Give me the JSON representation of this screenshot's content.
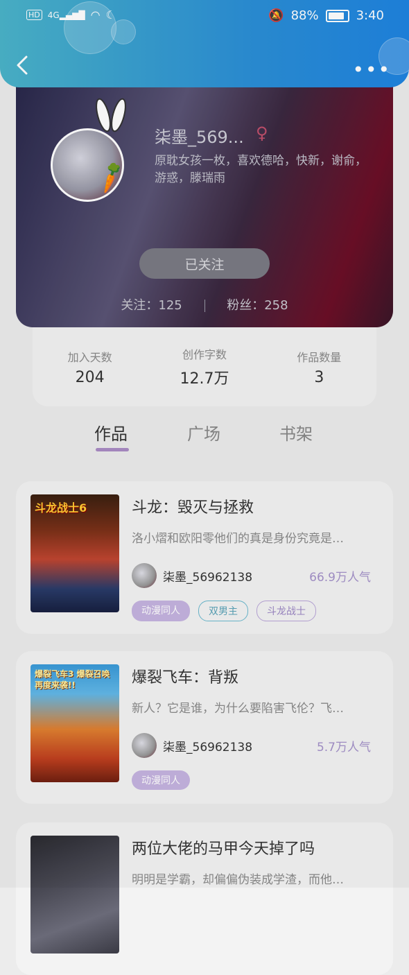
{
  "status_bar": {
    "network": "4G",
    "battery": "88%",
    "time": "3:40",
    "hd": "HD"
  },
  "profile": {
    "nickname": "柒墨_569...",
    "bio": "原耽女孩一枚，喜欢德哈，快新，谢俞，游惑，滕瑞雨",
    "follow_button": "已关注",
    "following_label": "关注：125",
    "followers_label": "粉丝：258"
  },
  "stats": [
    {
      "label": "加入天数",
      "value": "204"
    },
    {
      "label": "创作字数",
      "value": "12.7万"
    },
    {
      "label": "作品数量",
      "value": "3"
    }
  ],
  "tabs": [
    {
      "label": "作品",
      "active": true
    },
    {
      "label": "广场",
      "active": false
    },
    {
      "label": "书架",
      "active": false
    }
  ],
  "works": [
    {
      "title": "斗龙：毁灭与拯救",
      "desc": "洛小熠和欧阳零他们的真是身份究竟是…",
      "author": "柒墨_56962138",
      "popularity": "66.9万人气",
      "tags": [
        "动漫同人",
        "双男主",
        "斗龙战士"
      ],
      "cover_text": "斗龙战士6"
    },
    {
      "title": "爆裂飞车：背叛",
      "desc": "新人？它是谁，为什么要陷害飞伦？飞…",
      "author": "柒墨_56962138",
      "popularity": "5.7万人气",
      "tags": [
        "动漫同人"
      ],
      "cover_text": "爆裂飞车3 爆裂召唤 再度来袭!!"
    },
    {
      "title": "两位大佬的马甲今天掉了吗",
      "desc": "明明是学霸，却偏偏伪装成学渣，而他…"
    }
  ],
  "colors": {
    "accent": "#a98bc4",
    "header": "#2b8fd6"
  }
}
